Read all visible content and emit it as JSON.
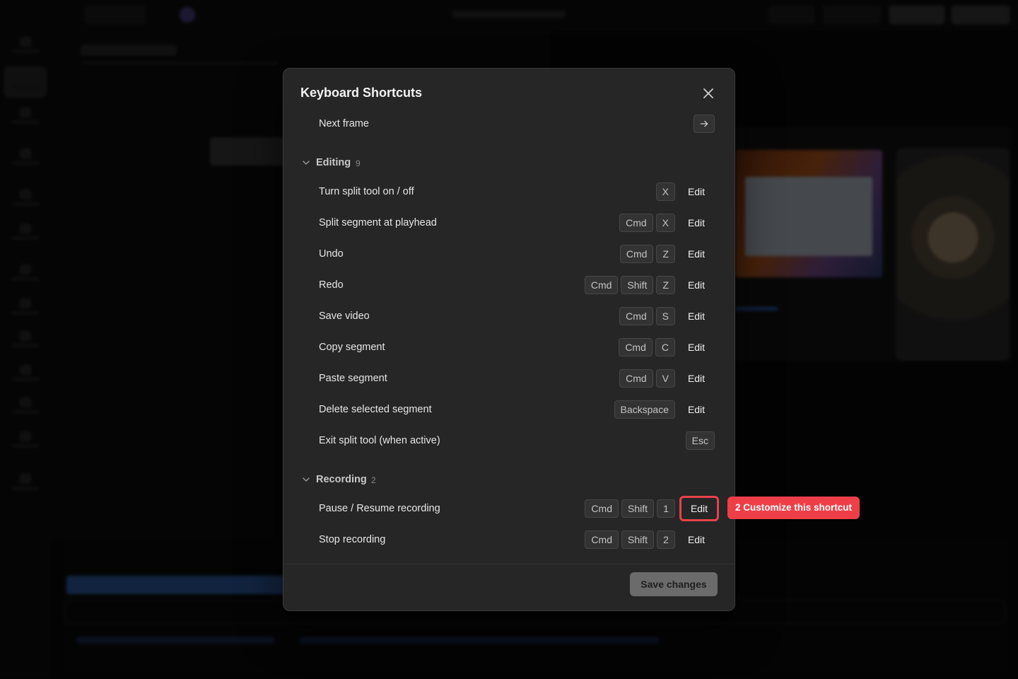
{
  "modal": {
    "title": "Keyboard Shortcuts",
    "close_label": "close",
    "save_label": "Save changes"
  },
  "top_row": {
    "label": "Next frame",
    "key_icon": "arrow-right-icon"
  },
  "sections": [
    {
      "name": "Editing",
      "count": "9",
      "rows": [
        {
          "label": "Turn split tool on / off",
          "keys": [
            "X"
          ],
          "edit": "Edit"
        },
        {
          "label": "Split segment at playhead",
          "keys": [
            "Cmd",
            "X"
          ],
          "edit": "Edit"
        },
        {
          "label": "Undo",
          "keys": [
            "Cmd",
            "Z"
          ],
          "edit": "Edit"
        },
        {
          "label": "Redo",
          "keys": [
            "Cmd",
            "Shift",
            "Z"
          ],
          "edit": "Edit"
        },
        {
          "label": "Save video",
          "keys": [
            "Cmd",
            "S"
          ],
          "edit": "Edit"
        },
        {
          "label": "Copy segment",
          "keys": [
            "Cmd",
            "C"
          ],
          "edit": "Edit"
        },
        {
          "label": "Paste segment",
          "keys": [
            "Cmd",
            "V"
          ],
          "edit": "Edit"
        },
        {
          "label": "Delete selected segment",
          "keys": [
            "Backspace"
          ],
          "edit": "Edit"
        },
        {
          "label": "Exit split tool (when active)",
          "keys": [
            "Esc"
          ],
          "edit": ""
        }
      ]
    },
    {
      "name": "Recording",
      "count": "2",
      "rows": [
        {
          "label": "Pause / Resume recording",
          "keys": [
            "Cmd",
            "Shift",
            "1"
          ],
          "edit": "Edit"
        },
        {
          "label": "Stop recording",
          "keys": [
            "Cmd",
            "Shift",
            "2"
          ],
          "edit": "Edit"
        }
      ]
    }
  ],
  "tooltip": {
    "text": "2 Customize this shortcut"
  },
  "colors": {
    "accent_red": "#ee3f48",
    "modal_bg": "#262626",
    "save_bg": "#6b6b6b"
  }
}
